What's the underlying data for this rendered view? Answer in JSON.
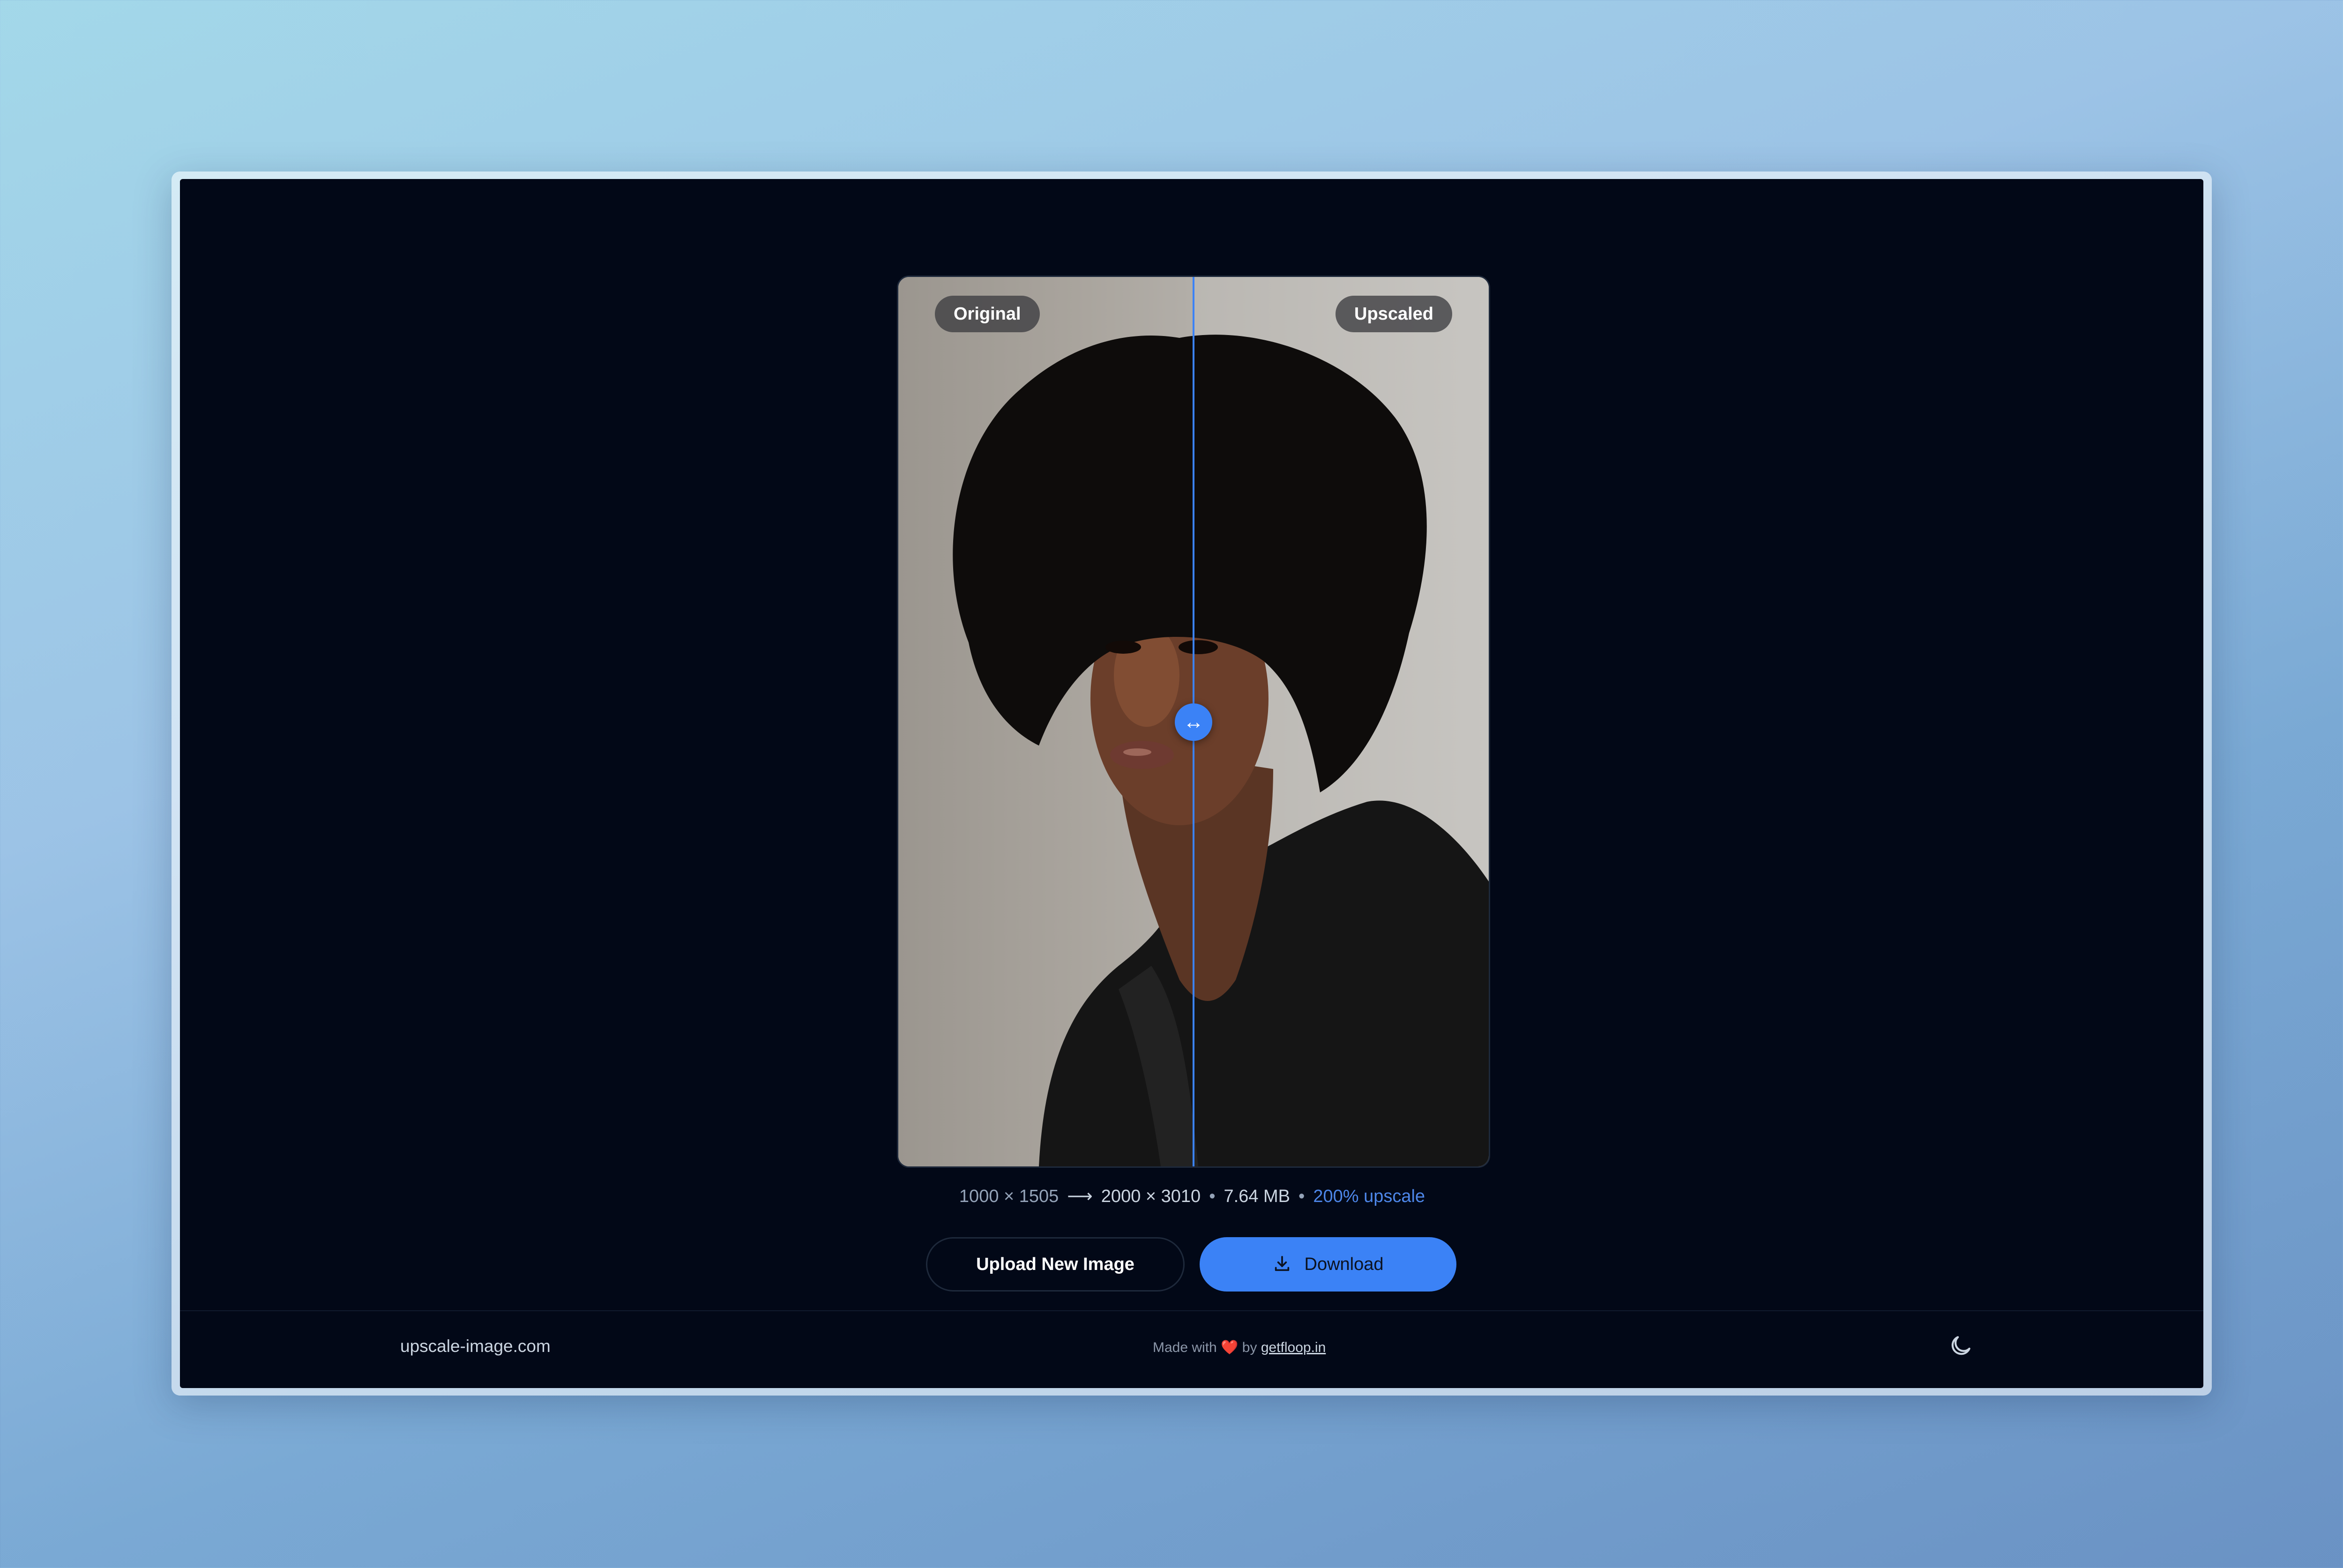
{
  "viewer": {
    "left_label": "Original",
    "right_label": "Upscaled",
    "split_percent": 50
  },
  "stats": {
    "original_dims": "1000 × 1505",
    "arrow": "⟶",
    "upscaled_dims": "2000 × 3010",
    "separator": "•",
    "file_size": "7.64 MB",
    "upscale_label": "200% upscale"
  },
  "actions": {
    "upload_label": "Upload New Image",
    "download_label": "Download"
  },
  "footer": {
    "brand": "upscale-image.com",
    "credit_prefix": "Made with",
    "heart": "❤️",
    "credit_by": "by",
    "credit_link": "getfloop.in"
  },
  "icons": {
    "divider_handle": "arrows-horizontal-icon",
    "download": "download-icon",
    "theme": "moon-icon"
  },
  "colors": {
    "accent": "#3b82f6",
    "background": "#020817",
    "upscale_text": "#4d86e8"
  }
}
